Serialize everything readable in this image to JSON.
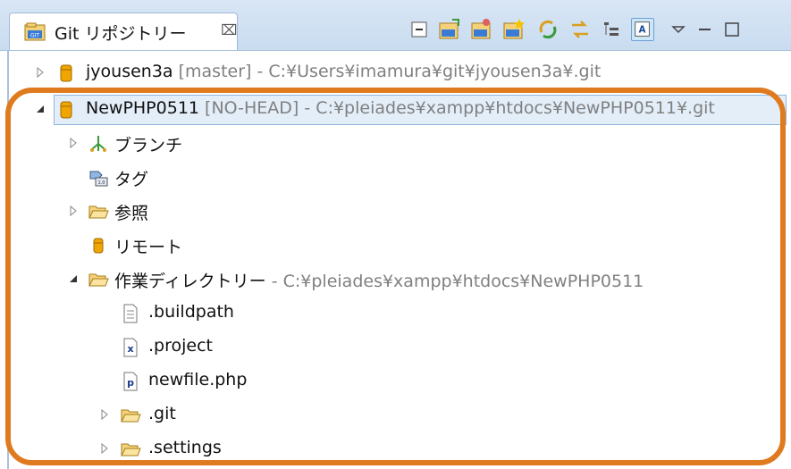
{
  "tab": {
    "title": "Git リポジトリー",
    "close": "⌧"
  },
  "toolbar": {
    "icons": [
      "collapse-all-icon",
      "add-repository-icon",
      "clone-repository-icon",
      "create-repository-icon",
      "refresh-icon",
      "link-with-selection-icon",
      "hierarchical-view-icon",
      "show-details-icon",
      "view-menu-icon",
      "minimize-icon",
      "maximize-icon"
    ]
  },
  "tree": {
    "repo1": {
      "name": "jyousen3a",
      "branch": "[master]",
      "path": "- C:¥Users¥imamura¥git¥jyousen3a¥.git"
    },
    "repo2": {
      "name": "NewPHP0511",
      "branch": "[NO-HEAD]",
      "path": "- C:¥pleiades¥xampp¥htdocs¥NewPHP0511¥.git"
    },
    "branches": "ブランチ",
    "tags": "タグ",
    "references": "参照",
    "remotes": "リモート",
    "working_dir": {
      "name": "作業ディレクトリー",
      "path": "- C:¥pleiades¥xampp¥htdocs¥NewPHP0511"
    },
    "files": {
      "buildpath": ".buildpath",
      "project": ".project",
      "newfile": "newfile.php",
      "git": ".git",
      "settings": ".settings"
    }
  },
  "colors": {
    "highlight": "#e07a1e",
    "selection": "#e3eef9",
    "folder": "#e8b84a",
    "repo": "#f0a500"
  }
}
